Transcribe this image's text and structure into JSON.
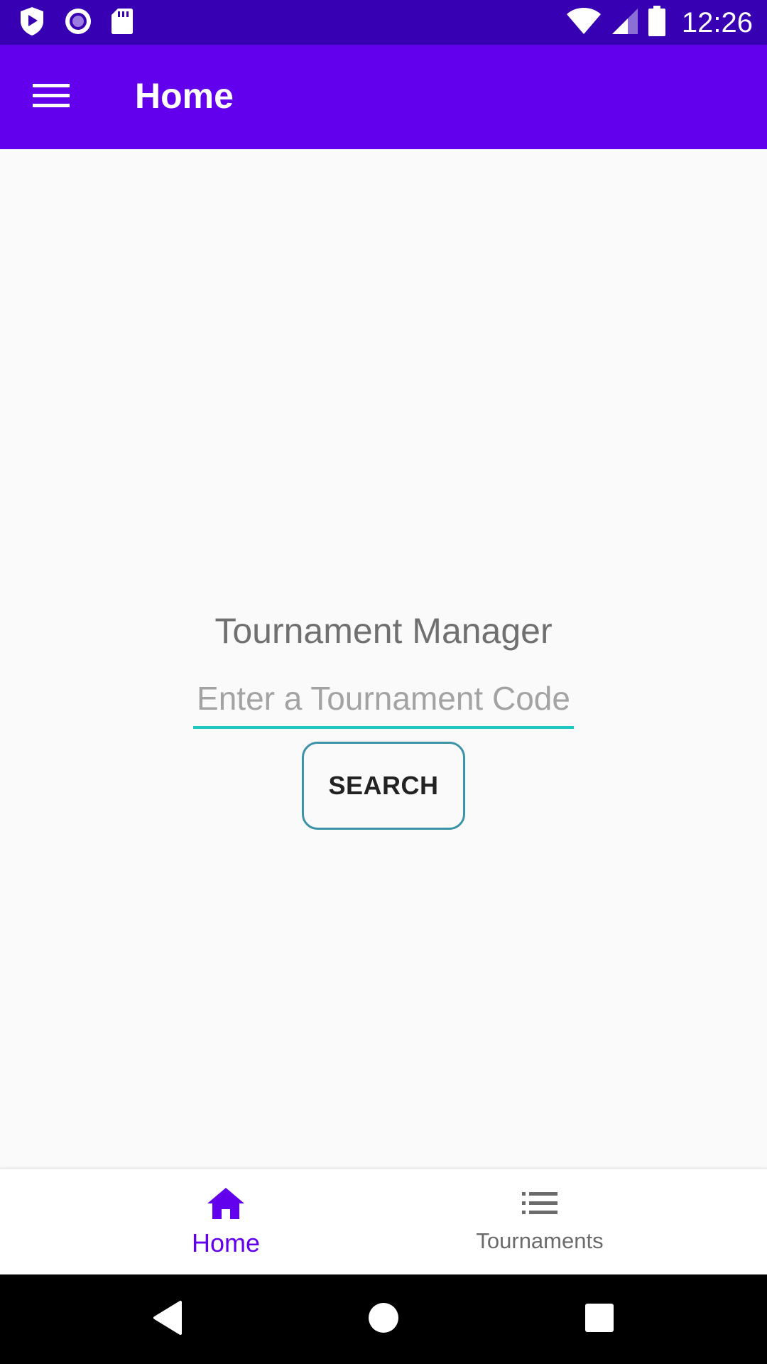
{
  "status_bar": {
    "time": "12:26",
    "left_icons": [
      "play-protect-icon",
      "record-icon",
      "sd-card-icon"
    ],
    "right_icons": [
      "wifi-icon",
      "cell-signal-icon",
      "battery-icon"
    ]
  },
  "app_bar": {
    "title": "Home",
    "menu_icon": "hamburger-menu-icon"
  },
  "main": {
    "heading": "Tournament Manager",
    "code_input": {
      "value": "",
      "placeholder": "Enter a Tournament Code"
    },
    "search_label": "SEARCH"
  },
  "bottom_nav": {
    "items": [
      {
        "label": "Home",
        "icon": "home-icon",
        "active": true
      },
      {
        "label": "Tournaments",
        "icon": "list-icon",
        "active": false
      }
    ]
  },
  "system_nav": {
    "buttons": [
      "back-icon",
      "home-circle-icon",
      "recents-icon"
    ]
  },
  "colors": {
    "status_bar": "#3700b3",
    "app_bar": "#6200ee",
    "accent_underline": "#1ac6c6",
    "button_border": "#3b93a8",
    "active_nav": "#6200ee"
  }
}
